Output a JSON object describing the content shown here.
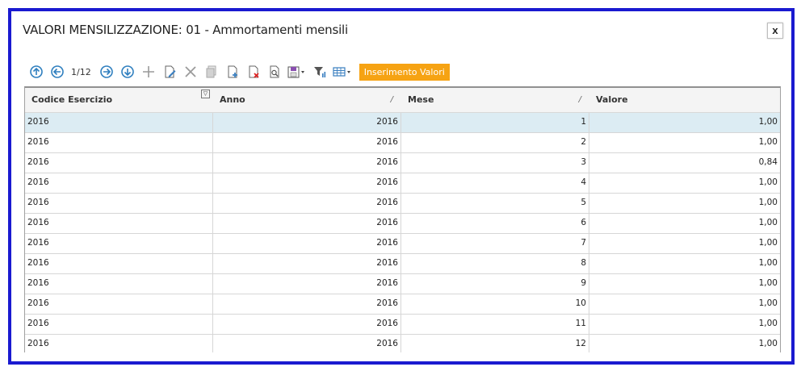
{
  "window": {
    "title": "VALORI MENSILIZZAZIONE: 01 - Ammortamenti mensili",
    "close_label": "x"
  },
  "toolbar": {
    "page_indicator": "1/12",
    "insert_values_label": "Inserimento Valori",
    "icons": [
      "first-record-icon",
      "previous-record-icon",
      "next-record-icon",
      "last-record-icon",
      "add-icon",
      "edit-icon",
      "delete-icon",
      "copy-icon",
      "new-document-icon",
      "cancel-document-icon",
      "preview-icon",
      "save-menu-icon",
      "filter-icon",
      "table-view-icon"
    ]
  },
  "grid": {
    "columns": [
      "Codice Esercizio",
      "Anno",
      "Mese",
      "Valore"
    ],
    "rows": [
      {
        "codice": "2016",
        "anno": "2016",
        "mese": "1",
        "valore": "1,00"
      },
      {
        "codice": "2016",
        "anno": "2016",
        "mese": "2",
        "valore": "1,00"
      },
      {
        "codice": "2016",
        "anno": "2016",
        "mese": "3",
        "valore": "0,84"
      },
      {
        "codice": "2016",
        "anno": "2016",
        "mese": "4",
        "valore": "1,00"
      },
      {
        "codice": "2016",
        "anno": "2016",
        "mese": "5",
        "valore": "1,00"
      },
      {
        "codice": "2016",
        "anno": "2016",
        "mese": "6",
        "valore": "1,00"
      },
      {
        "codice": "2016",
        "anno": "2016",
        "mese": "7",
        "valore": "1,00"
      },
      {
        "codice": "2016",
        "anno": "2016",
        "mese": "8",
        "valore": "1,00"
      },
      {
        "codice": "2016",
        "anno": "2016",
        "mese": "9",
        "valore": "1,00"
      },
      {
        "codice": "2016",
        "anno": "2016",
        "mese": "10",
        "valore": "1,00"
      },
      {
        "codice": "2016",
        "anno": "2016",
        "mese": "11",
        "valore": "1,00"
      },
      {
        "codice": "2016",
        "anno": "2016",
        "mese": "12",
        "valore": "1,00"
      }
    ]
  },
  "colors": {
    "frame_border": "#1a1ad0",
    "accent_button": "#f6a313",
    "selected_row": "#dcecf3",
    "nav_icon": "#2f7fbf"
  }
}
